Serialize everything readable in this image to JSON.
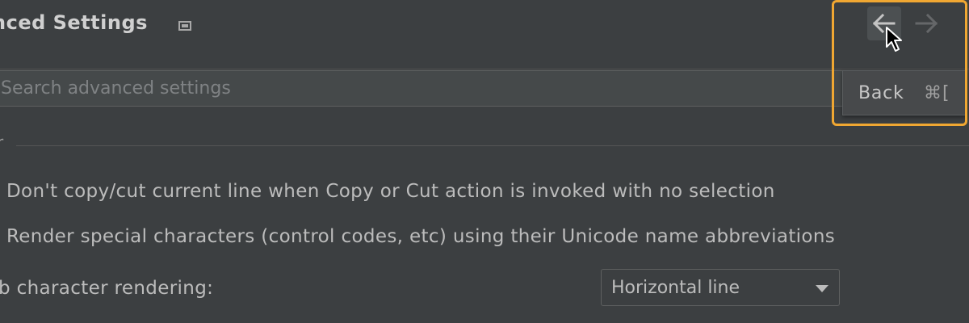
{
  "header": {
    "title": "nced Settings",
    "pin_icon": "restore-window-icon"
  },
  "search": {
    "placeholder": "Search advanced settings",
    "value": ""
  },
  "group": {
    "label_fragment": "r"
  },
  "settings": [
    {
      "label": "Don't copy/cut current line when Copy or Cut action is invoked with no selection"
    },
    {
      "label": "Render special characters (control codes, etc) using their Unicode name abbreviations"
    },
    {
      "label": "b character rendering:",
      "value": "Horizontal line"
    }
  ],
  "navigation": {
    "back_icon": "arrow-left-icon",
    "forward_icon": "arrow-right-icon",
    "tooltip": {
      "label": "Back",
      "shortcut": "⌘["
    }
  },
  "colors": {
    "background": "#3c3f41",
    "highlight": "#f0a732",
    "text": "#bbbbbb",
    "placeholder": "#7f8284"
  }
}
